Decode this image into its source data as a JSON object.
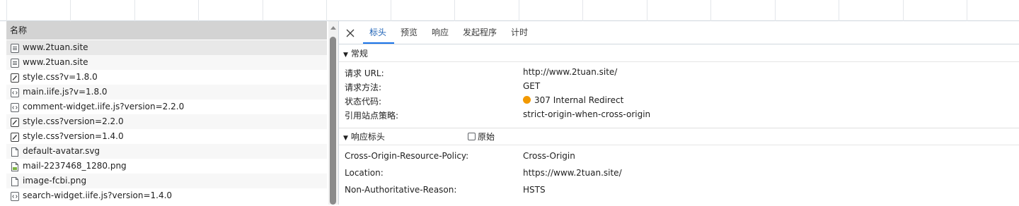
{
  "request_list": {
    "header": "名称",
    "rows": [
      {
        "name": "www.2tuan.site",
        "icon": "document-icon",
        "selected": true
      },
      {
        "name": "www.2tuan.site",
        "icon": "document-icon"
      },
      {
        "name": "style.css?v=1.8.0",
        "icon": "stylesheet-icon"
      },
      {
        "name": "main.iife.js?v=1.8.0",
        "icon": "script-icon"
      },
      {
        "name": "comment-widget.iife.js?version=2.2.0",
        "icon": "script-icon"
      },
      {
        "name": "style.css?version=2.2.0",
        "icon": "stylesheet-icon"
      },
      {
        "name": "style.css?version=1.4.0",
        "icon": "stylesheet-icon"
      },
      {
        "name": "default-avatar.svg",
        "icon": "file-icon"
      },
      {
        "name": "mail-2237468_1280.png",
        "icon": "image-file-icon"
      },
      {
        "name": "image-fcbi.png",
        "icon": "file-icon"
      },
      {
        "name": "search-widget.iife.js?version=1.4.0",
        "icon": "script-icon"
      }
    ]
  },
  "details": {
    "tabs": [
      {
        "label": "标头",
        "active": true
      },
      {
        "label": "预览"
      },
      {
        "label": "响应"
      },
      {
        "label": "发起程序"
      },
      {
        "label": "计时"
      }
    ],
    "general": {
      "title": "常规",
      "rows": [
        {
          "key": "请求 URL:",
          "value": "http://www.2tuan.site/"
        },
        {
          "key": "请求方法:",
          "value": "GET"
        },
        {
          "key": "状态代码:",
          "value": "307 Internal Redirect",
          "status_color": "#f29900"
        },
        {
          "key": "引用站点策略:",
          "value": "strict-origin-when-cross-origin"
        }
      ]
    },
    "response_headers": {
      "title": "响应标头",
      "raw_label": "原始",
      "raw_checked": false,
      "rows": [
        {
          "key": "Cross-Origin-Resource-Policy:",
          "value": "Cross-Origin"
        },
        {
          "key": "Location:",
          "value": "https://www.2tuan.site/"
        },
        {
          "key": "Non-Authoritative-Reason:",
          "value": "HSTS"
        }
      ]
    }
  },
  "colors": {
    "accent": "#1a73e8",
    "status_redirect": "#f29900",
    "selected_row": "#e8e8e8",
    "header_bg": "#d3d3d3"
  }
}
